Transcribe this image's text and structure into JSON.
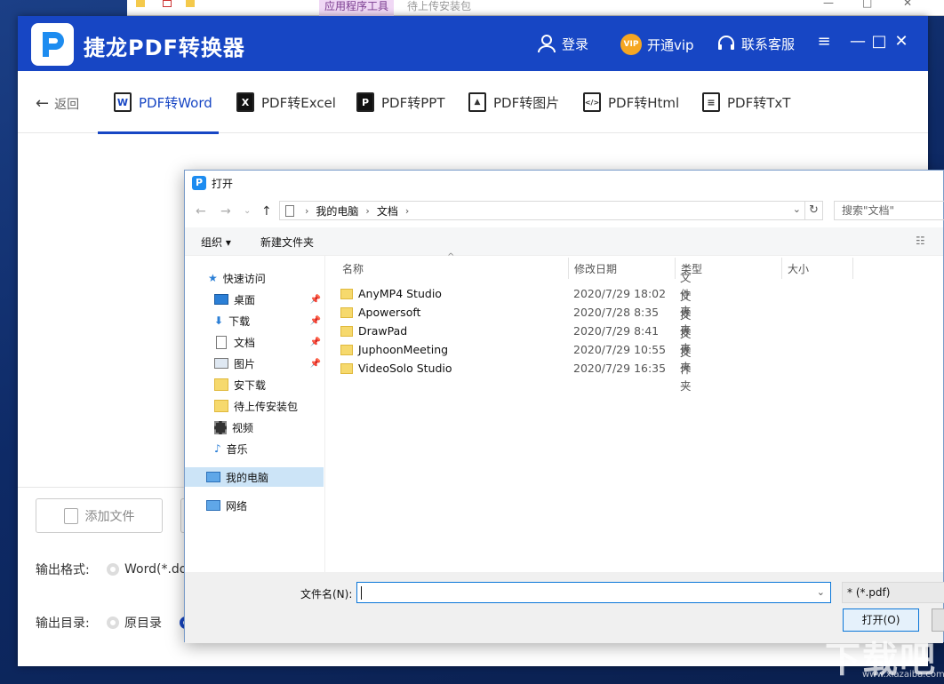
{
  "background_window": {
    "ribbon_label": "应用程序工具",
    "title": "待上传安装包"
  },
  "app": {
    "title": "捷龙PDF转换器",
    "login": "登录",
    "vip_badge": "VIP",
    "vip_label": "开通vip",
    "support": "联系客服",
    "back": "返回",
    "tabs": [
      {
        "label": "PDF转Word",
        "icon": "W"
      },
      {
        "label": "PDF转Excel",
        "icon": "X"
      },
      {
        "label": "PDF转PPT",
        "icon": "P"
      },
      {
        "label": "PDF转图片",
        "icon": "▲"
      },
      {
        "label": "PDF转Html",
        "icon": "</>"
      },
      {
        "label": "PDF转TxT",
        "icon": "≡"
      }
    ],
    "add_file": "添加文件",
    "output_format_label": "输出格式:",
    "output_format_value": "Word(*.do",
    "output_dir_label": "输出目录:",
    "output_dir_value": "原目录",
    "accent": "#1746c4"
  },
  "dialog": {
    "title": "打开",
    "breadcrumb": [
      "我的电脑",
      "文档"
    ],
    "search_placeholder": "搜索\"文档\"",
    "organize": "组织 ▾",
    "new_folder": "新建文件夹",
    "nav": [
      {
        "label": "快速访问"
      },
      {
        "label": "桌面"
      },
      {
        "label": "下载"
      },
      {
        "label": "文档"
      },
      {
        "label": "图片"
      },
      {
        "label": "安下载"
      },
      {
        "label": "待上传安装包"
      },
      {
        "label": "视频"
      },
      {
        "label": "音乐"
      },
      {
        "label": "我的电脑"
      },
      {
        "label": "网络"
      }
    ],
    "columns": [
      "名称",
      "修改日期",
      "类型",
      "大小"
    ],
    "files": [
      {
        "name": "AnyMP4 Studio",
        "date": "2020/7/29 18:02",
        "type": "文件夹"
      },
      {
        "name": "Apowersoft",
        "date": "2020/7/28 8:35",
        "type": "文件夹"
      },
      {
        "name": "DrawPad",
        "date": "2020/7/29 8:41",
        "type": "文件夹"
      },
      {
        "name": "JuphoonMeeting",
        "date": "2020/7/29 10:55",
        "type": "文件夹"
      },
      {
        "name": "VideoSolo Studio",
        "date": "2020/7/29 16:35",
        "type": "文件夹"
      }
    ],
    "filename_label": "文件名(N):",
    "filename_value": "",
    "filter": "* (*.pdf)",
    "open_button": "打开(O)"
  },
  "watermark": {
    "text": "下载吧",
    "url": "www.xiazaiba.com"
  }
}
